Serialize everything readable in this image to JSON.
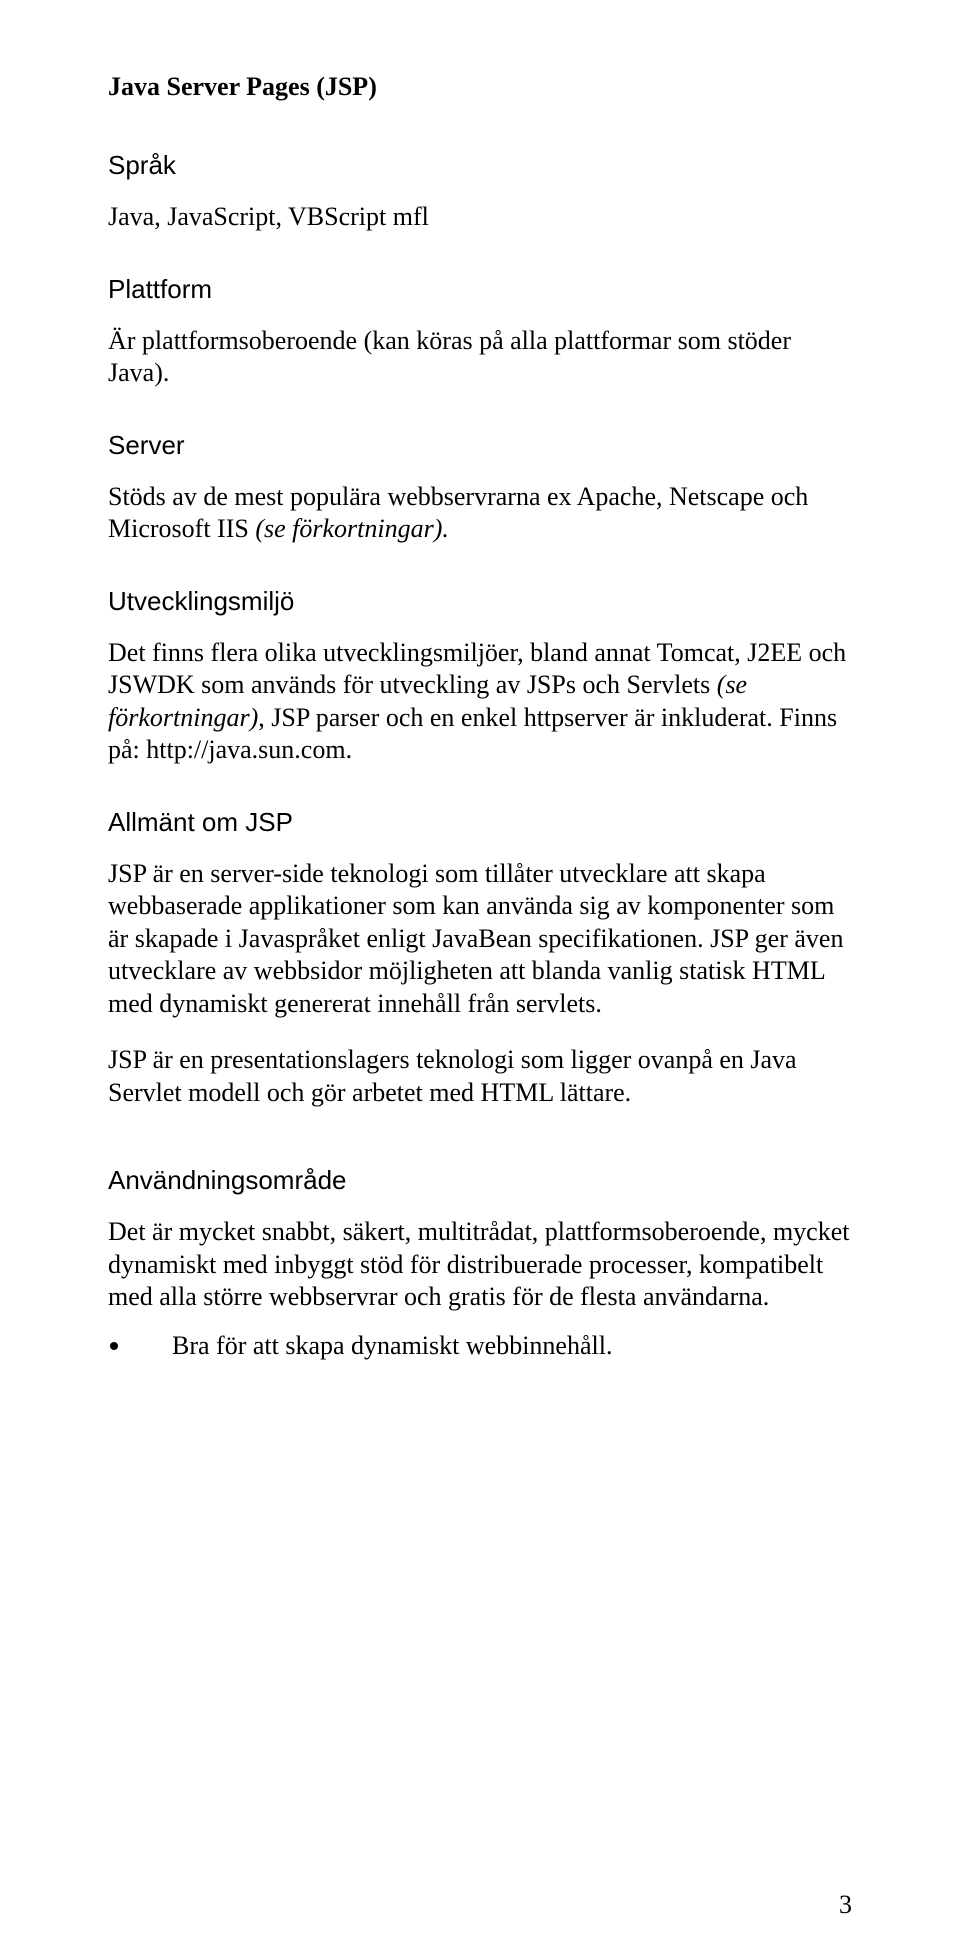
{
  "title": "Java Server Pages (JSP)",
  "sections": {
    "sprak": {
      "heading": "Språk",
      "body": "Java, JavaScript, VBScript mfl"
    },
    "plattform": {
      "heading": "Plattform",
      "body": "Är plattformsoberoende (kan köras på alla plattformar som stöder Java)."
    },
    "server": {
      "heading": "Server",
      "body_pre": "Stöds av de mest populära webbservrarna ex Apache, Netscape och Microsoft IIS ",
      "body_italic": "(se förkortningar).",
      "body_post": ""
    },
    "utvecklingsmiljo": {
      "heading": "Utvecklingsmiljö",
      "body_pre": "Det finns flera olika utvecklingsmiljöer, bland annat Tomcat, J2EE och JSWDK som används för utveckling av JSPs och Servlets ",
      "body_italic": "(se förkortningar)",
      "body_post": ", JSP parser och en enkel httpserver är inkluderat. Finns på: http://java.sun.com."
    },
    "allmant": {
      "heading": "Allmänt om JSP",
      "p1": "JSP är en server-side teknologi som tillåter utvecklare att skapa webbaserade applikationer som kan använda sig av komponenter som är skapade i Javaspråket enligt JavaBean specifikationen. JSP ger även utvecklare av webbsidor möjligheten att blanda vanlig statisk HTML med dynamiskt genererat innehåll från servlets.",
      "p2": "JSP är en presentationslagers teknologi som ligger ovanpå en Java Servlet modell och gör arbetet med HTML lättare."
    },
    "anvandningsomrade": {
      "heading": "Användningsområde",
      "p1": "Det är mycket snabbt, säkert, multitrådat, plattformsoberoende, mycket dynamiskt med inbyggt stöd för distribuerade processer, kompatibelt med alla större webbservrar och gratis för de flesta användarna.",
      "bullet1": "Bra för att skapa dynamiskt webbinnehåll."
    }
  },
  "page_number": "3"
}
